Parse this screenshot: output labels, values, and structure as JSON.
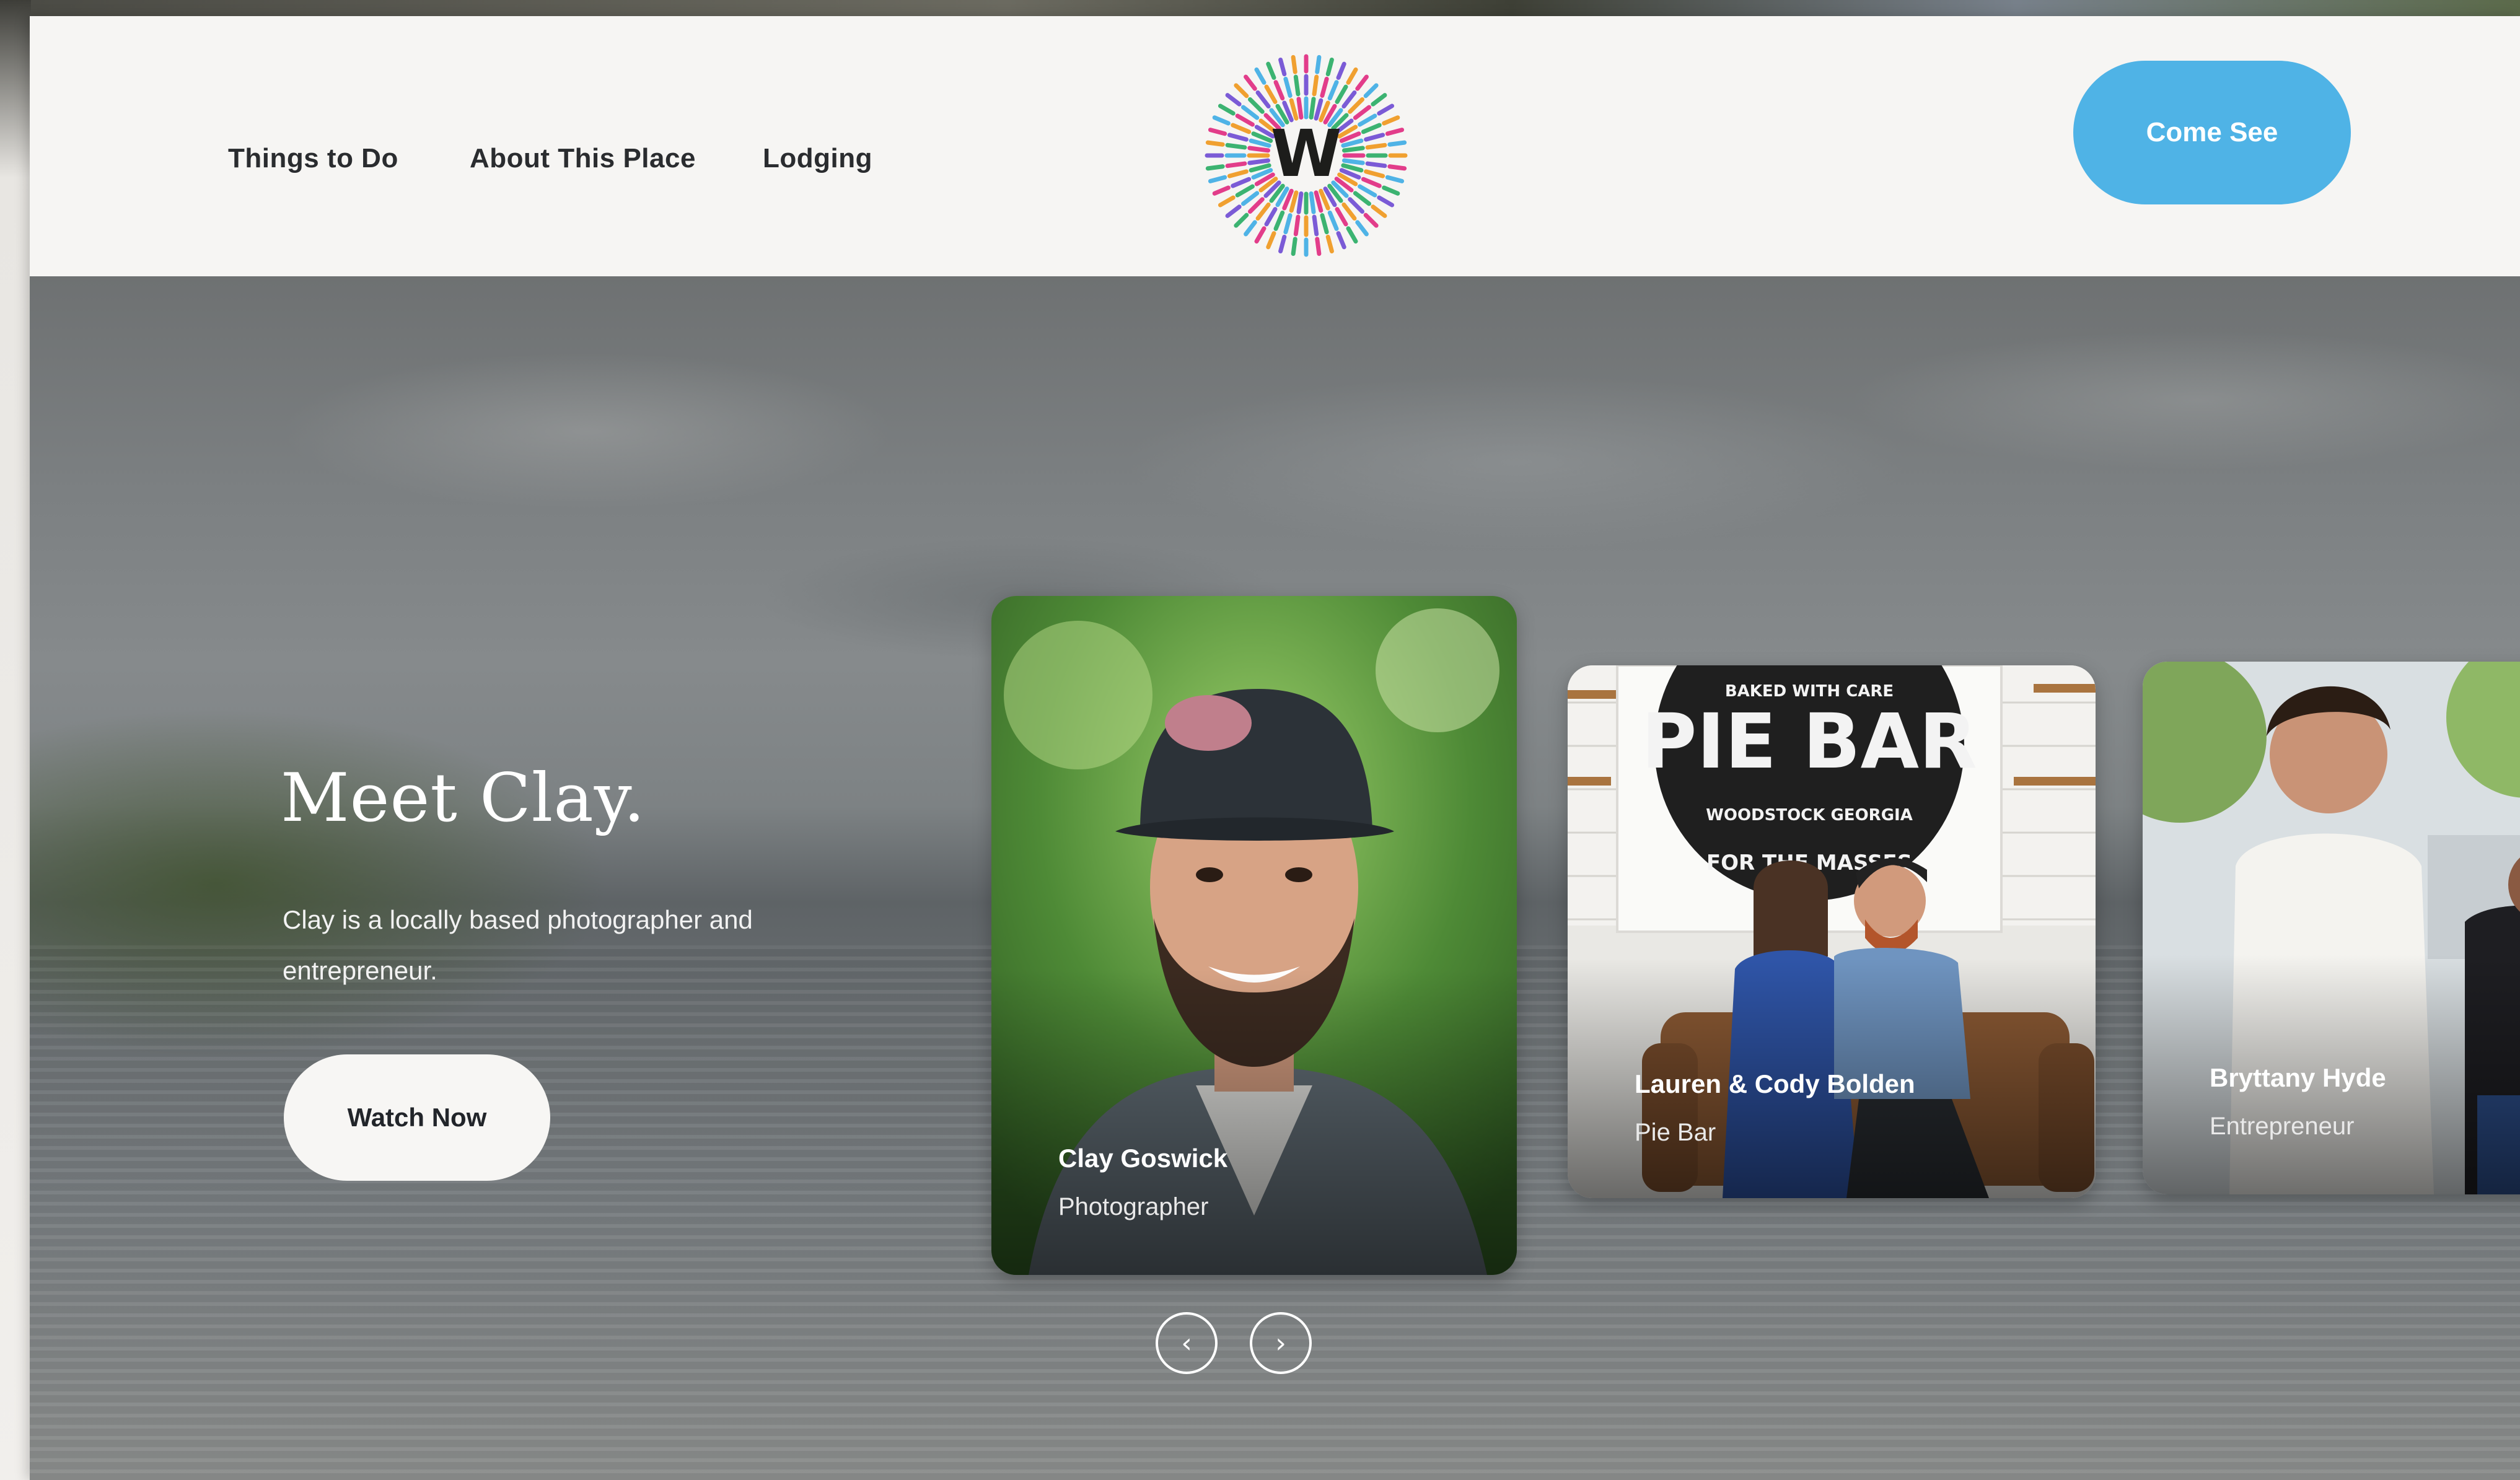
{
  "nav": {
    "items": [
      "Things to Do",
      "About This Place",
      "Lodging"
    ],
    "logo_letter": "W",
    "cta_label": "Come See"
  },
  "hero": {
    "title": "Meet Clay.",
    "description": "Clay is a locally based photographer and entrepreneur.",
    "button_label": "Watch Now"
  },
  "cards": [
    {
      "name": "Clay Goswick",
      "role": "Photographer"
    },
    {
      "name": "Lauren & Cody Bolden",
      "role": "Pie Bar",
      "sign_text": "PIE BAR",
      "sign_top": "BAKED WITH CARE",
      "sign_place": "WOODSTOCK GEORGIA",
      "sign_bottom": "FOR THE MASSES"
    },
    {
      "name": "Bryttany Hyde",
      "role": "Entrepreneur"
    }
  ],
  "carousel": {
    "prev_icon": "‹",
    "next_icon": "›"
  },
  "colors": {
    "accent": "#4fb3e6",
    "page_bg": "#f6f5f3",
    "logo_rays": [
      "#e23d8a",
      "#4fb3e6",
      "#3cb371",
      "#7b5bd6",
      "#f0a030"
    ]
  }
}
